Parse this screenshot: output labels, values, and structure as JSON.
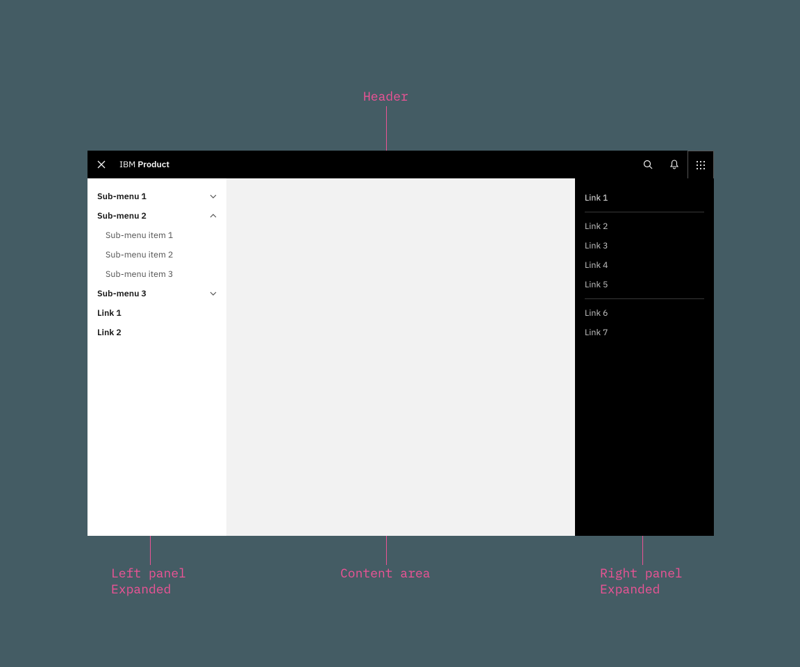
{
  "annotations": {
    "header": "Header",
    "left": "Left panel\nExpanded",
    "content": "Content area",
    "right": "Right panel\nExpanded"
  },
  "header": {
    "brand_prefix": "IBM",
    "brand_product": "Product"
  },
  "left_panel": {
    "submenu1": {
      "label": "Sub-menu 1"
    },
    "submenu2": {
      "label": "Sub-menu 2",
      "item1": "Sub-menu item 1",
      "item2": "Sub-menu item 2",
      "item3": "Sub-menu item 3"
    },
    "submenu3": {
      "label": "Sub-menu 3"
    },
    "link1": "Link 1",
    "link2": "Link 2"
  },
  "right_panel": {
    "link1": "Link 1",
    "link2": "Link 2",
    "link3": "Link 3",
    "link4": "Link 4",
    "link5": "Link 5",
    "link6": "Link 6",
    "link7": "Link 7"
  }
}
